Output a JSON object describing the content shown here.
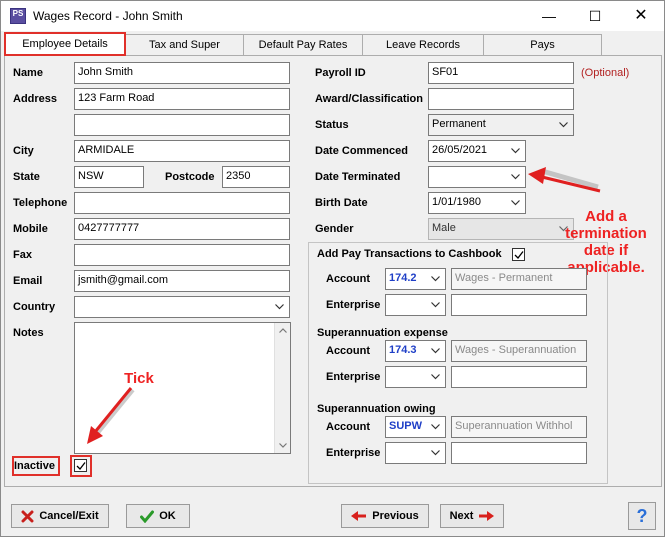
{
  "window": {
    "title": "Wages Record - John Smith",
    "app_icon_text": "PS",
    "minimize": "—",
    "maximize": "☐",
    "close": "✕"
  },
  "tabs": [
    {
      "label": "Employee Details",
      "active": true
    },
    {
      "label": "Tax and Super",
      "active": false
    },
    {
      "label": "Default Pay Rates",
      "active": false
    },
    {
      "label": "Leave Records",
      "active": false
    },
    {
      "label": "Pays",
      "active": false
    }
  ],
  "employee": {
    "name_label": "Name",
    "name": "John Smith",
    "address_label": "Address",
    "address1": "123 Farm Road",
    "address2": "",
    "city_label": "City",
    "city": "ARMIDALE",
    "state_label": "State",
    "state": "NSW",
    "postcode_label": "Postcode",
    "postcode": "2350",
    "telephone_label": "Telephone",
    "telephone": "",
    "mobile_label": "Mobile",
    "mobile": "0427777777",
    "fax_label": "Fax",
    "fax": "",
    "email_label": "Email",
    "email": "jsmith@gmail.com",
    "country_label": "Country",
    "country": "",
    "notes_label": "Notes",
    "notes": "",
    "inactive_label": "Inactive",
    "inactive": true
  },
  "payroll": {
    "payroll_id_label": "Payroll ID",
    "payroll_id": "SF01",
    "optional": "(Optional)",
    "award_label": "Award/Classification",
    "award": "",
    "status_label": "Status",
    "status": "Permanent",
    "date_commenced_label": "Date Commenced",
    "date_commenced": "26/05/2021",
    "date_terminated_label": "Date Terminated",
    "date_terminated": "",
    "birth_date_label": "Birth Date",
    "birth_date": "1/01/1980",
    "gender_label": "Gender",
    "gender": "Male"
  },
  "cashbook": {
    "heading": "Add Pay Transactions to Cashbook",
    "checked": true,
    "account_label": "Account",
    "enterprise_label": "Enterprise",
    "wages_account_code": "174.2",
    "wages_account_name": "Wages - Permanent",
    "wages_enterprise": "",
    "super_expense_heading": "Superannuation expense",
    "super_expense_code": "174.3",
    "super_expense_name": "Wages - Superannuation",
    "super_expense_enterprise": "",
    "super_owing_heading": "Superannuation owing",
    "super_owing_code": "SUPW",
    "super_owing_name": "Superannuation Withhol",
    "super_owing_enterprise": ""
  },
  "annotations": {
    "tick": "Tick",
    "termination_line1": "Add a",
    "termination_line2": "termination",
    "termination_line3": "date if",
    "termination_line4": "applicable."
  },
  "buttons": {
    "cancel": "Cancel/Exit",
    "ok": "OK",
    "previous": "Previous",
    "next": "Next",
    "help": "?"
  },
  "colors": {
    "accent_red": "#e0302a",
    "account_blue": "#1f3fc7"
  }
}
